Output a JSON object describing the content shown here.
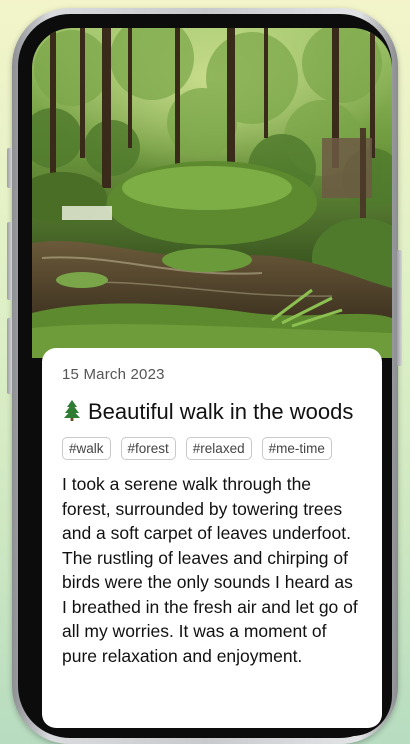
{
  "entry": {
    "date": "15 March 2023",
    "icon": "tree-icon",
    "title": "Beautiful walk in the woods",
    "tags": [
      "#walk",
      "#forest",
      "#relaxed",
      "#me-time"
    ],
    "body": "I took a serene walk through the forest, surrounded by towering trees and a soft carpet of leaves underfoot. The rustling of leaves and chirping of birds were the only sounds I heard as I breathed in the fresh air and let go of all my worries. It was a moment of pure relaxation and enjoyment."
  },
  "colors": {
    "background_top": "#f3f4c9",
    "background_bottom": "#b7dcc0",
    "card": "#ffffff",
    "tag_border": "#c9c9c9"
  }
}
